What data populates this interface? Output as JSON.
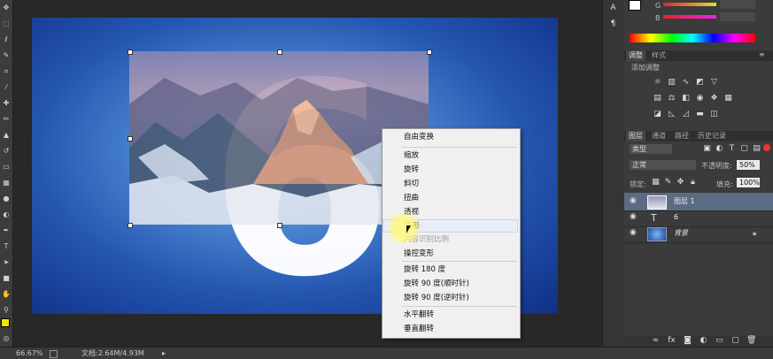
{
  "toolbar": {
    "tools": [
      "move-icon",
      "marquee-icon",
      "lasso-icon",
      "quick-select-icon",
      "crop-icon",
      "eyedropper-icon",
      "healing-icon",
      "brush-icon",
      "clone-stamp-icon",
      "history-brush-icon",
      "eraser-icon",
      "gradient-icon",
      "blur-icon",
      "dodge-icon",
      "pen-icon",
      "type-icon",
      "path-select-icon",
      "shape-icon",
      "hand-icon",
      "zoom-icon"
    ],
    "foreground": "#f2e600",
    "background": "#ffffff"
  },
  "canvas": {
    "text_layer": "6"
  },
  "context_menu": {
    "items": [
      "自由变换",
      "缩放",
      "旋转",
      "斜切",
      "扭曲",
      "透视",
      "变形",
      "内容识别比例",
      "操控变形",
      "旋转 180 度",
      "旋转 90 度(顺时针)",
      "旋转 90 度(逆时针)",
      "水平翻转",
      "垂直翻转"
    ],
    "disabled_items": [
      "内容识别比例"
    ],
    "highlighted_item": "变形"
  },
  "status_bar": {
    "zoom": "66.67%",
    "doc": "文档:2.64M/4.93M"
  },
  "color_panel": {
    "g_label": "G",
    "b_label": "B"
  },
  "adjustments_panel": {
    "tabs": [
      "调整",
      "样式"
    ],
    "title": "添加调整"
  },
  "layers_panel": {
    "tabs": [
      "图层",
      "通道",
      "路径",
      "历史记录"
    ],
    "kind_label": "类型",
    "blend_mode": "正常",
    "opacity_label": "不透明度:",
    "opacity_value": "50%",
    "lock_label": "锁定:",
    "fill_label": "填充:",
    "fill_value": "100%",
    "layers": [
      {
        "name": "图层 1",
        "type": "image",
        "selected": true
      },
      {
        "name": "6",
        "type": "text",
        "selected": false
      },
      {
        "name": "背景",
        "type": "background",
        "selected": false
      }
    ]
  },
  "colors": {
    "accent_selected_layer": "#5a6b83",
    "menu_highlight": "#e8eef7"
  }
}
